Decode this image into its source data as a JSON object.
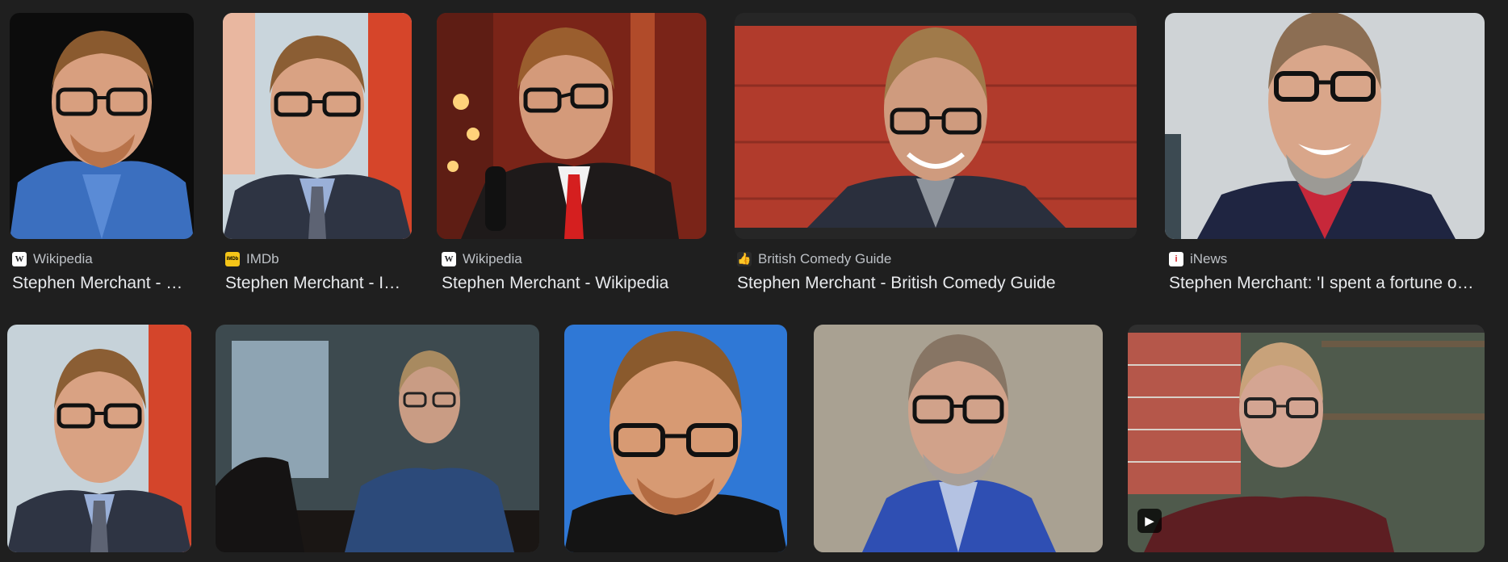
{
  "results": [
    {
      "source": "Wikipedia",
      "favicon": "wikipedia-icon",
      "title": "Stephen Merchant - Wikipedia"
    },
    {
      "source": "IMDb",
      "favicon": "imdb-icon",
      "title": "Stephen Merchant - IMDb"
    },
    {
      "source": "Wikipedia",
      "favicon": "wikipedia-icon",
      "title": "Stephen Merchant - Wikipedia"
    },
    {
      "source": "British Comedy Guide",
      "favicon": "british-comedy-guide-icon",
      "title": "Stephen Merchant - British Comedy Guide"
    },
    {
      "source": "iNews",
      "favicon": "inews-icon",
      "title": "Stephen Merchant: 'I spent a fortune on therapy'"
    }
  ],
  "favicon_glyphs": {
    "wiki": "W",
    "imdb": "IMDb",
    "bcg": "👍",
    "inews": "i"
  },
  "video_badge": "▶",
  "colors": {
    "page_bg": "#1f1f1f",
    "title_text": "#e8eaed",
    "source_text": "#bdc1c6"
  }
}
